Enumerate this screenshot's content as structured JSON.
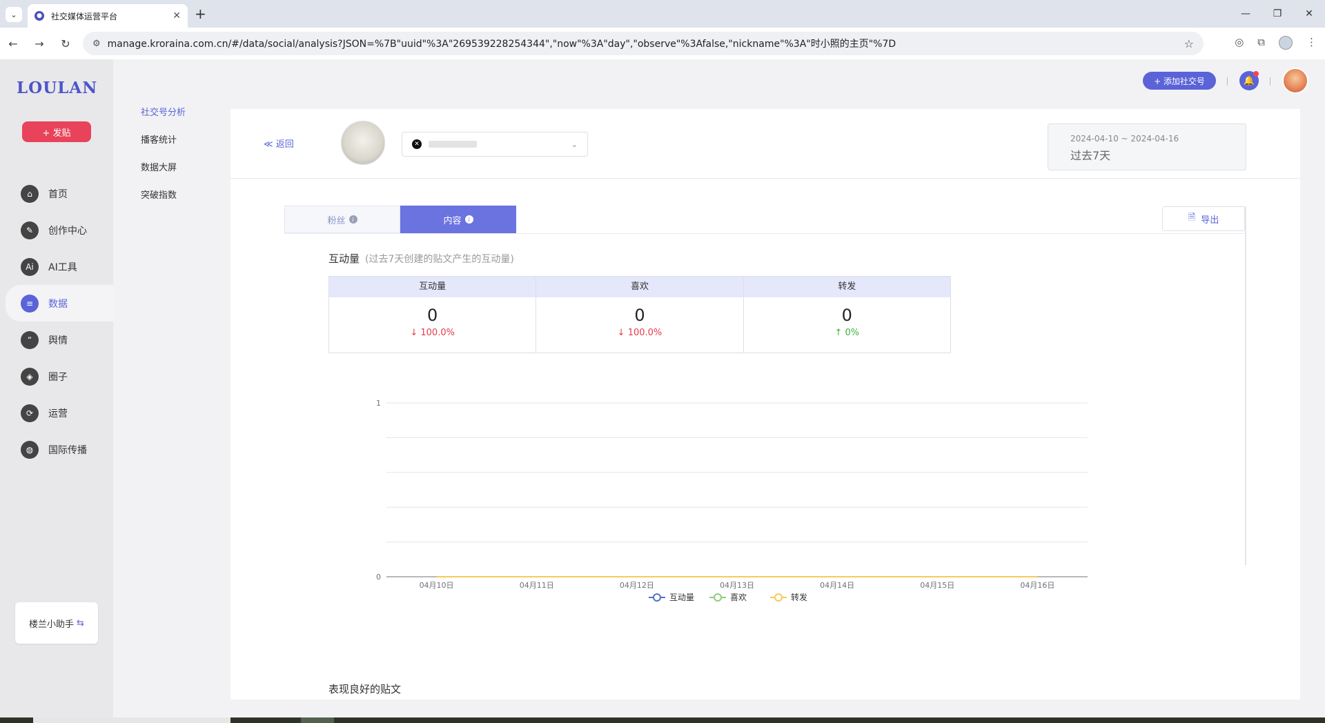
{
  "browser": {
    "tab_title": "社交媒体运营平台",
    "url": "manage.kroraina.com.cn/#/data/social/analysis?JSON=%7B\"uuid\"%3A\"269539228254344\",\"now\"%3A\"day\",\"observe\"%3Afalse,\"nickname\"%3A\"时小照的主页\"%7D"
  },
  "sidebar": {
    "logo": "LOULAN",
    "post_button": "+ 发贴",
    "items": [
      {
        "label": "首页",
        "icon": "home-icon"
      },
      {
        "label": "创作中心",
        "icon": "palette-icon"
      },
      {
        "label": "AI工具",
        "icon": "ai-icon"
      },
      {
        "label": "数据",
        "icon": "database-icon",
        "active": true
      },
      {
        "label": "舆情",
        "icon": "quote-icon"
      },
      {
        "label": "圈子",
        "icon": "compass-icon"
      },
      {
        "label": "运营",
        "icon": "cycle-icon"
      },
      {
        "label": "国际传播",
        "icon": "globe-icon"
      }
    ],
    "helper": "楼兰小助手"
  },
  "subnav": {
    "items": [
      "社交号分析",
      "播客统计",
      "数据大屏",
      "突破指数"
    ],
    "active_index": 0
  },
  "header": {
    "add_social": "+ 添加社交号",
    "back": "≪ 返回",
    "date_range": "2024-04-10 ~ 2024-04-16",
    "period": "过去7天"
  },
  "tabs": [
    {
      "label": "粉丝",
      "active": false
    },
    {
      "label": "内容",
      "active": true
    }
  ],
  "export_label": "导出",
  "metrics": {
    "title": "互动量",
    "subtitle": "(过去7天创建的贴文产生的互动量)",
    "columns": [
      {
        "header": "互动量",
        "value": "0",
        "change": "100.0%",
        "direction": "down"
      },
      {
        "header": "喜欢",
        "value": "0",
        "change": "100.0%",
        "direction": "down"
      },
      {
        "header": "转发",
        "value": "0",
        "change": "0%",
        "direction": "up"
      }
    ]
  },
  "chart_data": {
    "type": "line",
    "x": [
      "04月10日",
      "04月11日",
      "04月12日",
      "04月13日",
      "04月14日",
      "04月15日",
      "04月16日"
    ],
    "ylim": [
      0,
      1
    ],
    "y_ticks": [
      "1",
      "0"
    ],
    "grid": true,
    "legend_position": "bottom",
    "series": [
      {
        "name": "互动量",
        "values": [
          0,
          0,
          0,
          0,
          0,
          0,
          0
        ],
        "color": "#5470c6"
      },
      {
        "name": "喜欢",
        "values": [
          0,
          0,
          0,
          0,
          0,
          0,
          0
        ],
        "color": "#91cc75"
      },
      {
        "name": "转发",
        "values": [
          0,
          0,
          0,
          0,
          0,
          0,
          0
        ],
        "color": "#fac858"
      }
    ]
  },
  "section_title": "表现良好的贴文"
}
